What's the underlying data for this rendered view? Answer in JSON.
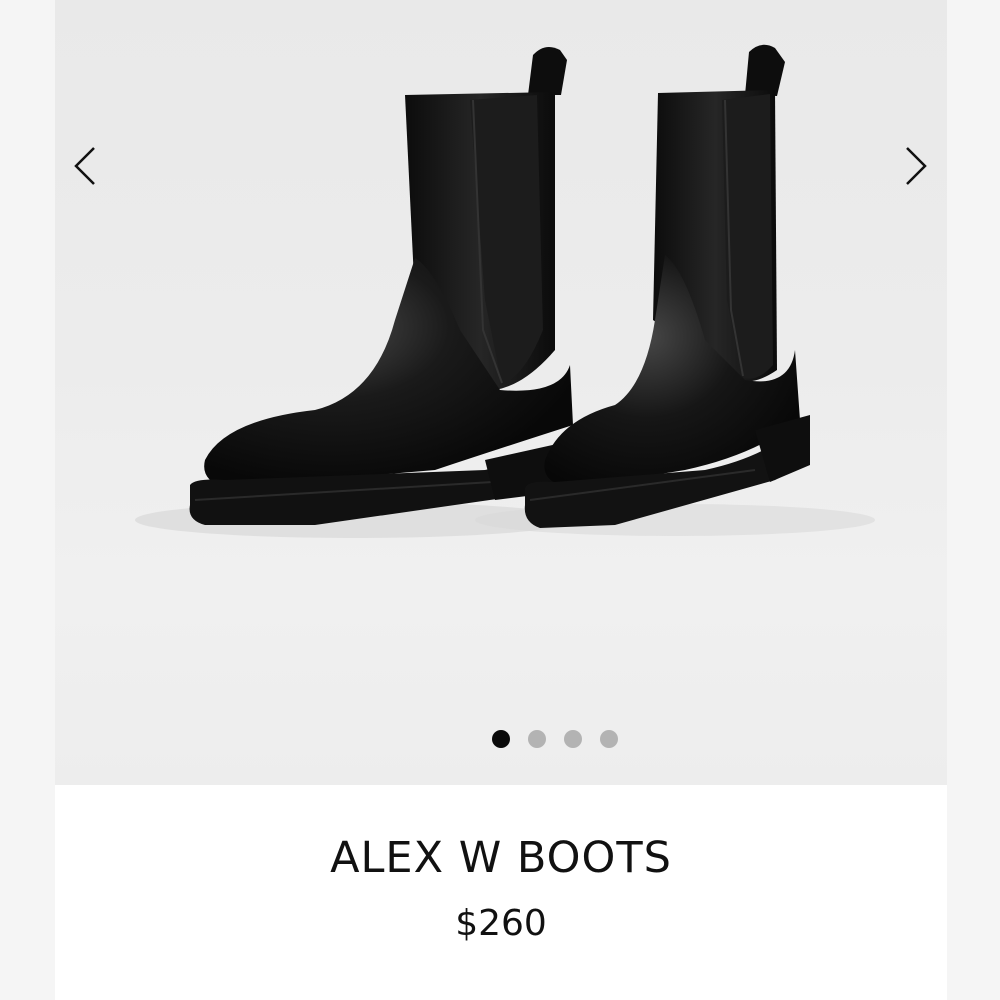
{
  "product": {
    "name": "ALEX W BOOTS",
    "price": "$260"
  },
  "gallery": {
    "image_icon": "chelsea-boots-image",
    "prev_icon": "chevron-left-icon",
    "next_icon": "chevron-right-icon",
    "image_count": 4,
    "active_index": 0
  },
  "colors": {
    "background": "#f3f3f3",
    "gallery_bg": "#ececec",
    "info_bg": "#ffffff",
    "dot_active": "#0a0a0a",
    "dot_inactive": "#b3b3b3",
    "boot": "#111111"
  }
}
